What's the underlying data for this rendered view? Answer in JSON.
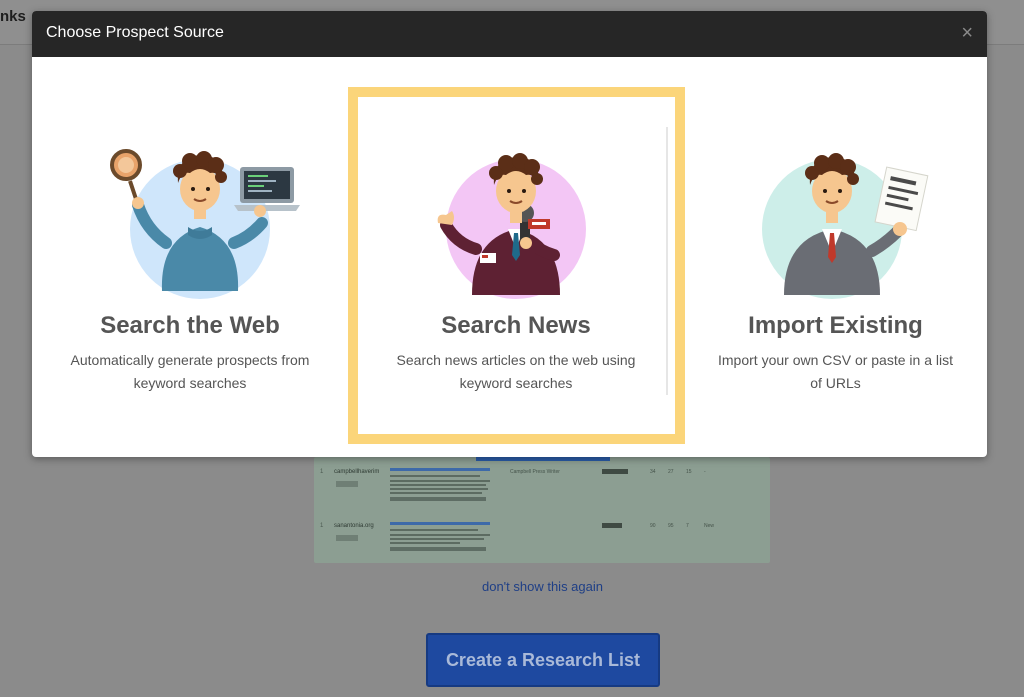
{
  "background": {
    "tab_fragment": "nks",
    "preview_rows": [
      {
        "num": "1",
        "domain": "campbellhaverim",
        "headline": "",
        "source": "Campbell Press Writer",
        "cells": [
          "34",
          "27",
          "15",
          "-"
        ]
      },
      {
        "num": "1",
        "domain": "sanantonia.org",
        "headline": "",
        "source": "",
        "cells": [
          "90",
          "95",
          "7",
          "New"
        ]
      }
    ],
    "dont_show_link": "don't show this again",
    "create_button": "Create a Research List"
  },
  "modal": {
    "title": "Choose Prospect Source",
    "close_symbol": "×",
    "options": [
      {
        "title": "Search the Web",
        "desc_line1": "Automatically generate prospects from",
        "desc_line2": "keyword searches",
        "icon": "web-search-illustration"
      },
      {
        "title": "Search News",
        "desc_line1": "Search news articles on the web using",
        "desc_line2": "keyword searches",
        "icon": "news-reporter-illustration"
      },
      {
        "title": "Import Existing",
        "desc_line1": "Import your own CSV or paste in a list",
        "desc_line2": "of URLs",
        "icon": "document-import-illustration"
      }
    ],
    "selected_option": "Search News",
    "highlight_color": "#fbd57a"
  },
  "colors": {
    "header_bg": "#262626",
    "text_gray": "#555555",
    "accent_blue": "#1e49a0"
  }
}
